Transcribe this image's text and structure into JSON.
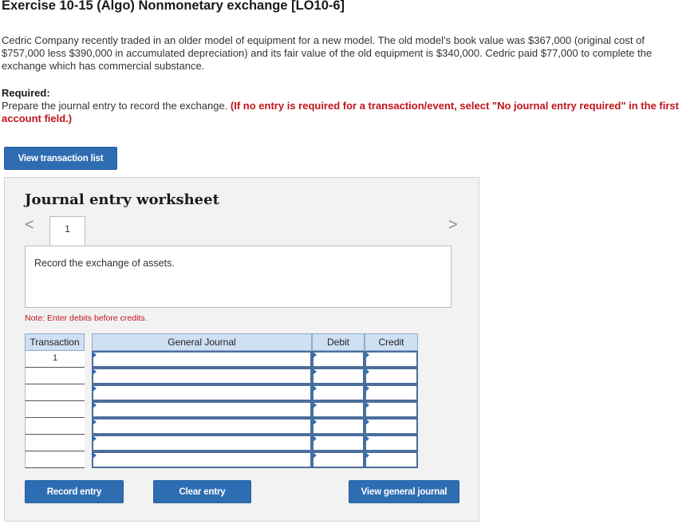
{
  "exercise": {
    "title": "Exercise 10-15 (Algo) Nonmonetary exchange [LO10-6]",
    "problem_text": "Cedric Company recently traded in an older model of equipment for a new model. The old model’s book value was $367,000 (original cost of $757,000 less $390,000 in accumulated depreciation) and its fair value of the old equipment is $340,000. Cedric paid $77,000 to complete the exchange which has commercial substance.",
    "required_label": "Required:",
    "instruction_text": "Prepare the journal entry to record the exchange.",
    "instruction_note": "(If no entry is required for a transaction/event, select \"No journal entry required\" in the first account field.)"
  },
  "buttons": {
    "view_transaction_list": "View transaction list",
    "record_entry": "Record entry",
    "clear_entry": "Clear entry",
    "view_general_journal": "View general journal"
  },
  "worksheet": {
    "title": "Journal entry worksheet",
    "nav_prev": "<",
    "nav_next": ">",
    "active_tab": "1",
    "description": "Record the exchange of assets.",
    "note": "Note: Enter debits before credits.",
    "columns": {
      "transaction": "Transaction",
      "general_journal": "General Journal",
      "debit": "Debit",
      "credit": "Credit"
    },
    "rows": [
      {
        "transaction": "1",
        "account": "",
        "debit": "",
        "credit": ""
      },
      {
        "transaction": "",
        "account": "",
        "debit": "",
        "credit": ""
      },
      {
        "transaction": "",
        "account": "",
        "debit": "",
        "credit": ""
      },
      {
        "transaction": "",
        "account": "",
        "debit": "",
        "credit": ""
      },
      {
        "transaction": "",
        "account": "",
        "debit": "",
        "credit": ""
      },
      {
        "transaction": "",
        "account": "",
        "debit": "",
        "credit": ""
      },
      {
        "transaction": "",
        "account": "",
        "debit": "",
        "credit": ""
      }
    ]
  },
  "colors": {
    "accent_blue": "#2f6db3",
    "note_red": "#c0141c",
    "header_blue": "#cfe0f3"
  }
}
